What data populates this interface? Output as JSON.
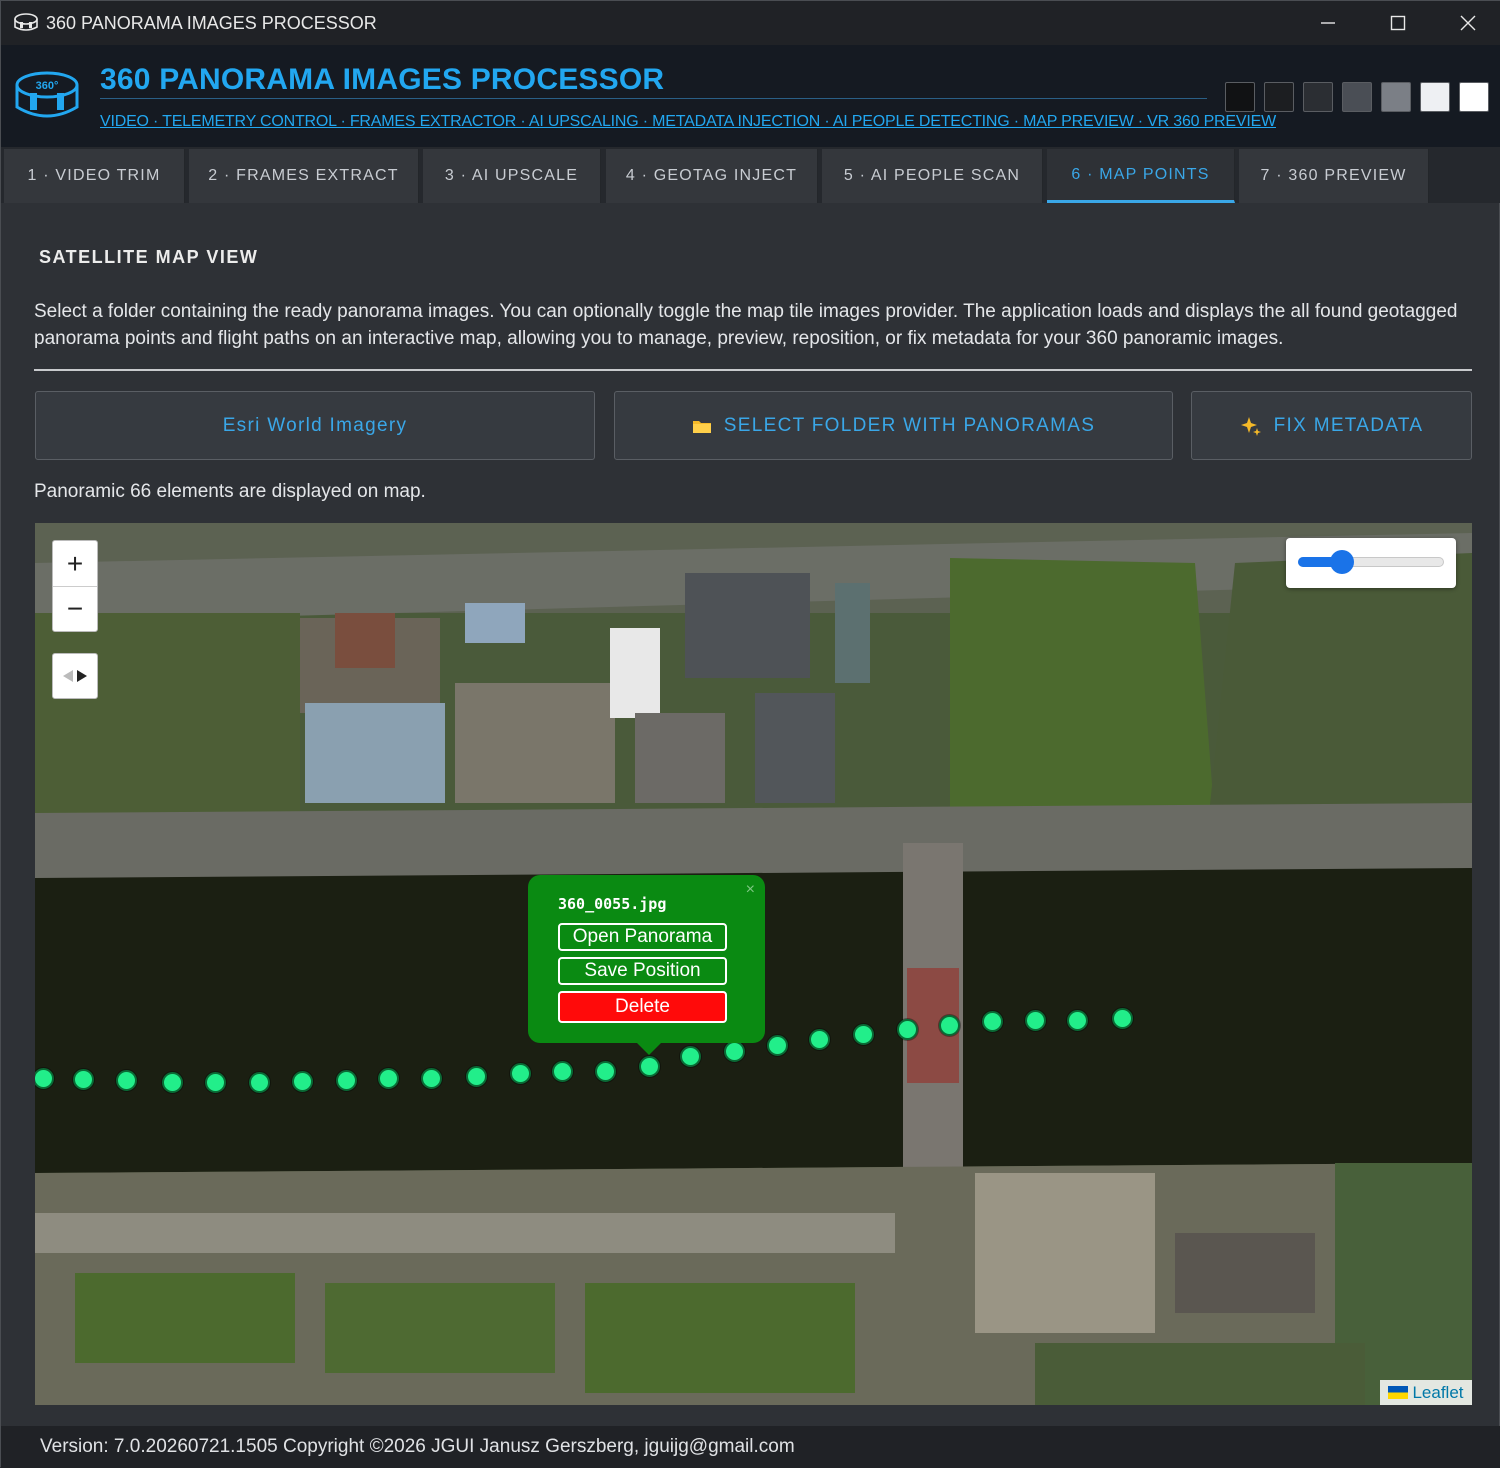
{
  "window": {
    "title": "360 PANORAMA IMAGES PROCESSOR"
  },
  "header": {
    "app_title": "360 PANORAMA IMAGES PROCESSOR",
    "subtitle": "VIDEO · TELEMETRY CONTROL · FRAMES EXTRACTOR · AI UPSCALING · METADATA INJECTION · AI PEOPLE DETECTING · MAP PREVIEW · VR 360 PREVIEW",
    "logo_text": "360°",
    "theme_swatches": [
      "#111214",
      "#1c1e21",
      "#2b2e33",
      "#4a4e55",
      "#7b7f86",
      "#eef0f3",
      "#ffffff"
    ]
  },
  "tabs": [
    {
      "label": "1 · VIDEO TRIM",
      "active": false
    },
    {
      "label": "2 · FRAMES EXTRACT",
      "active": false
    },
    {
      "label": "3 · AI UPSCALE",
      "active": false
    },
    {
      "label": "4 · GEOTAG INJECT",
      "active": false
    },
    {
      "label": "5 · AI PEOPLE SCAN",
      "active": false
    },
    {
      "label": "6 · MAP POINTS",
      "active": true
    },
    {
      "label": "7 · 360 PREVIEW",
      "active": false
    }
  ],
  "content": {
    "section_title": "SATELLITE MAP VIEW",
    "description": "Select a folder containing the ready panorama images. You can optionally toggle the map tile images provider. The application loads and displays the all found geotagged panorama points and flight paths on an interactive map, allowing you to manage, preview, reposition, or fix metadata for your 360 panoramic images.",
    "provider_button": "Esri World Imagery",
    "folder_button": "SELECT FOLDER WITH PANORAMAS",
    "fix_button": "FIX METADATA",
    "status": "Panoramic 66 elements are displayed on map."
  },
  "map": {
    "zoom_in": "+",
    "zoom_out": "−",
    "opacity": 0.3,
    "attribution": "Leaflet",
    "popup": {
      "filename": "360_0055.jpg",
      "open_label": "Open Panorama",
      "save_label": "Save Position",
      "delete_label": "Delete",
      "close": "×"
    },
    "marker_color": "#22ee8a"
  },
  "footer": {
    "version": "Version: 7.0.20260721.1505 Copyright ©2026 JGUI Janusz Gerszberg, jguijg@gmail.com"
  },
  "colors": {
    "accent": "#3aa7e8",
    "popup_bg": "#0a8a12",
    "delete_bg": "#ff0a0a"
  }
}
